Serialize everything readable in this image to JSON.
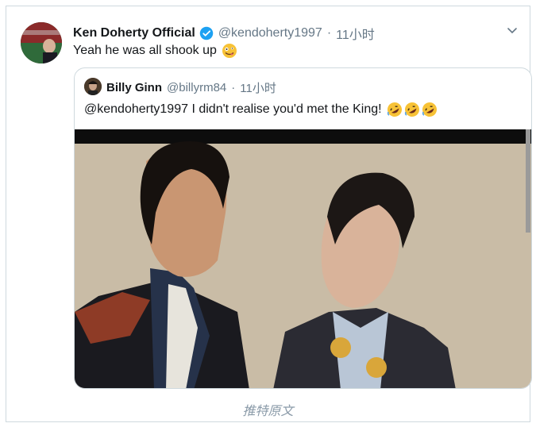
{
  "tweet": {
    "display_name": "Ken Doherty Official",
    "handle": "@kendoherty1997",
    "separator": "·",
    "time": "11小时",
    "text": "Yeah he was all shook up",
    "emoji": "zany-face-emoji"
  },
  "quoted_tweet": {
    "display_name": "Billy Ginn",
    "handle": "@billyrm84",
    "separator": "·",
    "time": "11小时",
    "text": "@kendoherty1997 I didn't realise you'd met the King!",
    "emoji_count": 3,
    "emoji": "rolling-on-floor-laughing-emoji"
  },
  "footer": {
    "link_label": "推特原文"
  },
  "colors": {
    "text": "#14171a",
    "secondary": "#657786",
    "verified": "#1da1f2",
    "border": "#cfd9de"
  }
}
